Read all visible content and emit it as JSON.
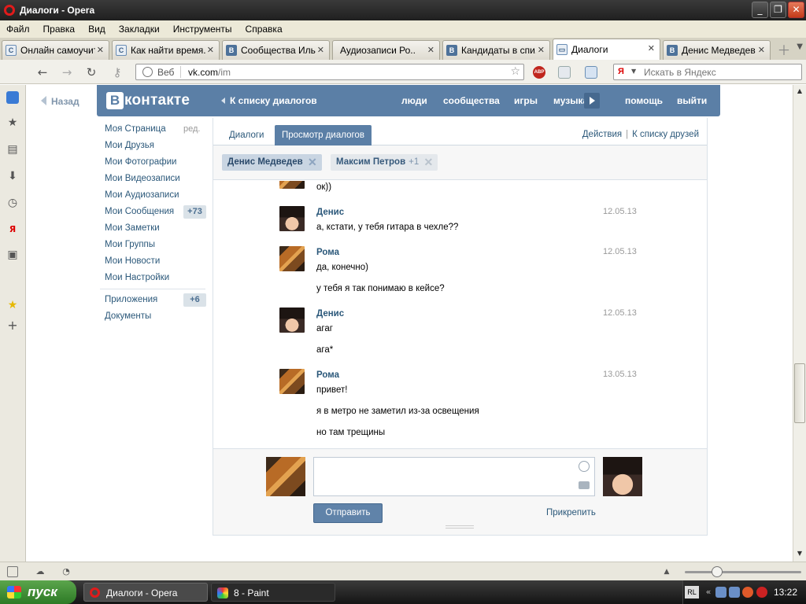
{
  "window": {
    "title": "Диалоги - Opera"
  },
  "menu": [
    "Файл",
    "Правка",
    "Вид",
    "Закладки",
    "Инструменты",
    "Справка"
  ],
  "tabs": [
    {
      "label": "Онлайн самоучит...",
      "icon": "C"
    },
    {
      "label": "Как найти время...",
      "icon": "C"
    },
    {
      "label": "Сообщества Иль...",
      "icon": "B"
    },
    {
      "label": "Аудиозаписи Ро...",
      "icon": "play"
    },
    {
      "label": "Кандидаты в спи...",
      "icon": "B"
    },
    {
      "label": "Диалоги",
      "icon": "chat",
      "active": true
    },
    {
      "label": "Денис Медведев",
      "icon": "B"
    }
  ],
  "address": {
    "scheme_label": "Веб",
    "host": "vk.com",
    "path": "/im"
  },
  "search": {
    "placeholder": "Искать в Яндекс",
    "engine": "Я"
  },
  "vk": {
    "back": "Назад",
    "logo_letter": "В",
    "logo_word": "контакте",
    "to_dialogs": "К списку диалогов",
    "topnav": [
      "люди",
      "сообщества",
      "игры",
      "музыка",
      "помощь",
      "выйти"
    ],
    "left_menu": [
      {
        "label": "Моя Страница",
        "extra": "ред."
      },
      {
        "label": "Мои Друзья"
      },
      {
        "label": "Мои Фотографии"
      },
      {
        "label": "Мои Видеозаписи"
      },
      {
        "label": "Мои Аудиозаписи"
      },
      {
        "label": "Мои Сообщения",
        "badge": "+73"
      },
      {
        "label": "Мои Заметки"
      },
      {
        "label": "Мои Группы"
      },
      {
        "label": "Мои Новости"
      },
      {
        "label": "Мои Настройки"
      },
      {
        "label": "Приложения",
        "badge": "+6"
      },
      {
        "label": "Документы"
      }
    ],
    "im_tabs": [
      "Диалоги",
      "Просмотр диалогов"
    ],
    "actions": [
      "Действия",
      "К списку друзей"
    ],
    "peers": [
      {
        "name": "Денис Медведев"
      },
      {
        "name": "Максим Петров",
        "extra": "+1"
      }
    ],
    "messages": [
      {
        "author": "",
        "date": "",
        "lines": [
          "ок))"
        ],
        "avatar": "roma"
      },
      {
        "author": "Денис",
        "date": "12.05.13",
        "lines": [
          "а, кстати, у тебя гитара в чехле??"
        ],
        "avatar": "denis"
      },
      {
        "author": "Рома",
        "date": "12.05.13",
        "lines": [
          "да, конечно)",
          "у тебя я так понимаю в кейсе?"
        ],
        "avatar": "roma"
      },
      {
        "author": "Денис",
        "date": "12.05.13",
        "lines": [
          "агаг",
          "ага*"
        ],
        "avatar": "denis"
      },
      {
        "author": "Рома",
        "date": "13.05.13",
        "lines": [
          "привет!",
          "я в метро не заметил из-за освещения",
          "но там трещины"
        ],
        "avatar": "roma"
      }
    ],
    "compose": {
      "send": "Отправить",
      "attach": "Прикрепить",
      "value": ""
    }
  },
  "taskbar": {
    "start": "пуск",
    "tasks": [
      "Диалоги - Opera",
      "8 - Paint"
    ],
    "lang": "RL",
    "clock": "13:22"
  },
  "colors": {
    "vk_blue": "#5b7fa6",
    "link": "#2b587a",
    "taskbar_green": "#3a8f30"
  }
}
